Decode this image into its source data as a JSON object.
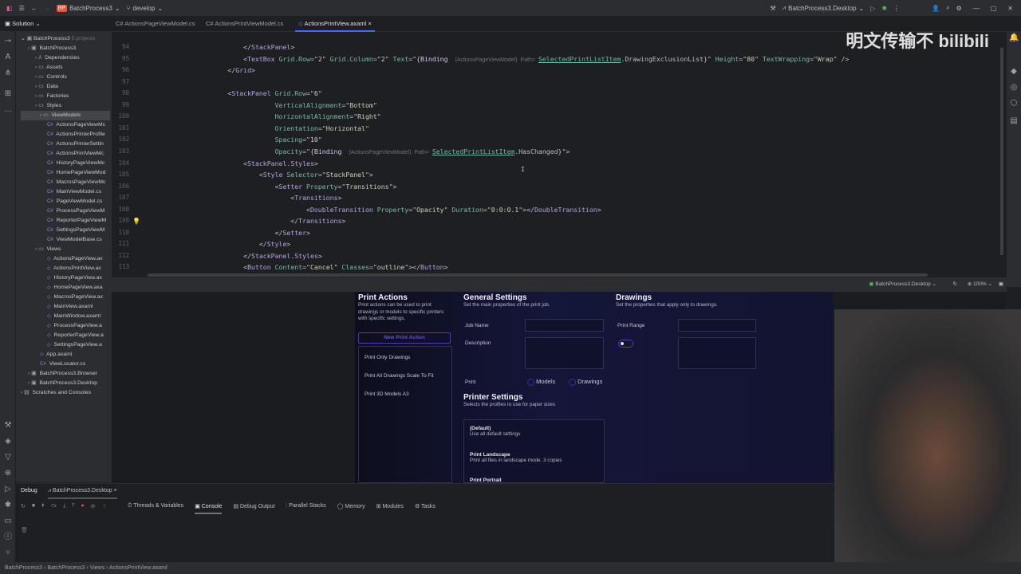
{
  "topbar": {
    "project": "BatchProcess3",
    "project_badge": "BP",
    "branch": "develop",
    "run_config": "BatchProcess3.Desktop"
  },
  "tabs": [
    {
      "label": "ActionsPageViewModel.cs"
    },
    {
      "label": "ActionsPrintViewModel.cs"
    },
    {
      "label": "ActionsPrintView.axaml"
    }
  ],
  "solution": {
    "header": "Solution",
    "root": "BatchProcess3",
    "root_note": "5 projects",
    "items": [
      {
        "label": "BatchProcess3",
        "kind": "project",
        "d": 1
      },
      {
        "label": "Dependencies",
        "kind": "dep",
        "d": 2
      },
      {
        "label": "Assets",
        "kind": "folder",
        "d": 2
      },
      {
        "label": "Controls",
        "kind": "folder",
        "d": 2
      },
      {
        "label": "Data",
        "kind": "folder",
        "d": 2
      },
      {
        "label": "Factories",
        "kind": "folder",
        "d": 2
      },
      {
        "label": "Styles",
        "kind": "folder",
        "d": 2
      },
      {
        "label": "ViewModels",
        "kind": "folder",
        "d": 2
      },
      {
        "label": "ActionsPageViewMc",
        "kind": "cs",
        "d": 3
      },
      {
        "label": "ActionsPrinterProfile",
        "kind": "cs",
        "d": 3
      },
      {
        "label": "ActionsPrinterSettin",
        "kind": "cs",
        "d": 3
      },
      {
        "label": "ActionsPrintViewMc",
        "kind": "cs",
        "d": 3
      },
      {
        "label": "HistoryPageViewMc",
        "kind": "cs",
        "d": 3
      },
      {
        "label": "HomePageViewMod",
        "kind": "cs",
        "d": 3
      },
      {
        "label": "MacrosPageViewMc",
        "kind": "cs",
        "d": 3
      },
      {
        "label": "MainViewModel.cs",
        "kind": "cs",
        "d": 3
      },
      {
        "label": "PageViewModel.cs",
        "kind": "cs",
        "d": 3
      },
      {
        "label": "ProcessPageViewM",
        "kind": "cs",
        "d": 3
      },
      {
        "label": "ReporterPageViewM",
        "kind": "cs",
        "d": 3
      },
      {
        "label": "SettingsPageViewM",
        "kind": "cs",
        "d": 3
      },
      {
        "label": "ViewModelBase.cs",
        "kind": "cs",
        "d": 3
      },
      {
        "label": "Views",
        "kind": "folder",
        "d": 2
      },
      {
        "label": "ActionsPageView.ax",
        "kind": "xaml",
        "d": 3
      },
      {
        "label": "ActionsPrintView.ax",
        "kind": "xaml",
        "d": 3
      },
      {
        "label": "HistoryPageView.ax",
        "kind": "xaml",
        "d": 3
      },
      {
        "label": "HomePageView.axa",
        "kind": "xaml",
        "d": 3
      },
      {
        "label": "MacrosPageView.ax",
        "kind": "xaml",
        "d": 3
      },
      {
        "label": "MainView.axaml",
        "kind": "xaml",
        "d": 3
      },
      {
        "label": "MainWindow.axaml",
        "kind": "xaml",
        "d": 3
      },
      {
        "label": "ProcessPageView.a",
        "kind": "xaml",
        "d": 3
      },
      {
        "label": "ReporterPageView.a",
        "kind": "xaml",
        "d": 3
      },
      {
        "label": "SettingsPageView.a",
        "kind": "xaml",
        "d": 3
      },
      {
        "label": "App.axaml",
        "kind": "xaml",
        "d": 2
      },
      {
        "label": "ViewLocator.cs",
        "kind": "cs",
        "d": 2
      },
      {
        "label": "BatchProcess3.Browser",
        "kind": "project",
        "d": 1
      },
      {
        "label": "BatchProcess3.Desktop",
        "kind": "project",
        "d": 1
      },
      {
        "label": "Scratches and Consoles",
        "kind": "scratch",
        "d": 0
      }
    ]
  },
  "code": [
    {
      "n": "94",
      "s": [
        [
          "punc",
          "            </"
        ],
        [
          "tag",
          "StackPanel"
        ],
        [
          "punc",
          ">"
        ]
      ]
    },
    {
      "n": "95",
      "s": [
        [
          "punc",
          "            <"
        ],
        [
          "tag",
          "TextBox "
        ],
        [
          "attr",
          "Grid.Row"
        ],
        [
          "punc",
          "=\""
        ],
        [
          "val",
          "2"
        ],
        [
          "punc",
          "\" "
        ],
        [
          "attr",
          "Grid.Column"
        ],
        [
          "punc",
          "=\""
        ],
        [
          "val",
          "2"
        ],
        [
          "punc",
          "\" "
        ],
        [
          "attr",
          "Text"
        ],
        [
          "punc",
          "=\"{"
        ],
        [
          "kw",
          "Binding "
        ],
        [
          "hint",
          "(ActionsPageViewModel)  Path="
        ],
        [
          "ref",
          "SelectedPrintListItem"
        ],
        [
          "punc",
          ".DrawingExclusionList}\" "
        ],
        [
          "attr",
          "Height"
        ],
        [
          "punc",
          "=\""
        ],
        [
          "val",
          "80"
        ],
        [
          "punc",
          "\" "
        ],
        [
          "attr",
          "TextWrapping"
        ],
        [
          "punc",
          "=\""
        ],
        [
          "val",
          "Wrap"
        ],
        [
          "punc",
          "\" />"
        ]
      ]
    },
    {
      "n": "96",
      "s": [
        [
          "punc",
          "        </"
        ],
        [
          "tag",
          "Grid"
        ],
        [
          "punc",
          ">"
        ]
      ]
    },
    {
      "n": "97",
      "s": []
    },
    {
      "n": "98",
      "s": [
        [
          "punc",
          "        <"
        ],
        [
          "tag",
          "StackPanel "
        ],
        [
          "attr",
          "Grid.Row"
        ],
        [
          "punc",
          "=\""
        ],
        [
          "val",
          "6"
        ],
        [
          "punc",
          "\""
        ]
      ]
    },
    {
      "n": "99",
      "s": [
        [
          "punc",
          "                    "
        ],
        [
          "attr",
          "VerticalAlignment"
        ],
        [
          "punc",
          "=\""
        ],
        [
          "val",
          "Bottom"
        ],
        [
          "punc",
          "\""
        ]
      ]
    },
    {
      "n": "100",
      "s": [
        [
          "punc",
          "                    "
        ],
        [
          "attr",
          "HorizontalAlignment"
        ],
        [
          "punc",
          "=\""
        ],
        [
          "val",
          "Right"
        ],
        [
          "punc",
          "\""
        ]
      ]
    },
    {
      "n": "101",
      "s": [
        [
          "punc",
          "                    "
        ],
        [
          "attr",
          "Orientation"
        ],
        [
          "punc",
          "=\""
        ],
        [
          "val",
          "Horizontal"
        ],
        [
          "punc",
          "\""
        ]
      ]
    },
    {
      "n": "102",
      "s": [
        [
          "punc",
          "                    "
        ],
        [
          "attr",
          "Spacing"
        ],
        [
          "punc",
          "=\""
        ],
        [
          "val",
          "10"
        ],
        [
          "punc",
          "\""
        ]
      ]
    },
    {
      "n": "103",
      "s": [
        [
          "punc",
          "                    "
        ],
        [
          "attr",
          "Opacity"
        ],
        [
          "punc",
          "=\"{"
        ],
        [
          "kw",
          "Binding "
        ],
        [
          "hint",
          "(ActionsPageViewModel)  Path="
        ],
        [
          "ref",
          "SelectedPrintListItem"
        ],
        [
          "punc",
          ".HasChanged}\">"
        ]
      ]
    },
    {
      "n": "104",
      "s": [
        [
          "punc",
          "            <"
        ],
        [
          "tag",
          "StackPanel.Styles"
        ],
        [
          "punc",
          ">"
        ]
      ]
    },
    {
      "n": "105",
      "s": [
        [
          "punc",
          "                <"
        ],
        [
          "tag",
          "Style "
        ],
        [
          "attr",
          "Selector"
        ],
        [
          "punc",
          "=\""
        ],
        [
          "val",
          "StackPanel"
        ],
        [
          "punc",
          "\">"
        ]
      ]
    },
    {
      "n": "106",
      "s": [
        [
          "punc",
          "                    <"
        ],
        [
          "tag",
          "Setter "
        ],
        [
          "attr",
          "Property"
        ],
        [
          "punc",
          "=\""
        ],
        [
          "val",
          "Transitions"
        ],
        [
          "punc",
          "\">"
        ]
      ]
    },
    {
      "n": "107",
      "s": [
        [
          "punc",
          "                        <"
        ],
        [
          "tag",
          "Transitions"
        ],
        [
          "punc",
          ">"
        ]
      ]
    },
    {
      "n": "108",
      "s": [
        [
          "punc",
          "                            <"
        ],
        [
          "tag",
          "DoubleTransition "
        ],
        [
          "attr",
          "Property"
        ],
        [
          "punc",
          "=\""
        ],
        [
          "val",
          "Opacity"
        ],
        [
          "punc",
          "\" "
        ],
        [
          "attr",
          "Duration"
        ],
        [
          "punc",
          "=\""
        ],
        [
          "val",
          "0:0:0.1"
        ],
        [
          "punc",
          "\"></"
        ],
        [
          "tag",
          "DoubleTransition"
        ],
        [
          "punc",
          ">"
        ]
      ]
    },
    {
      "n": "109",
      "s": [
        [
          "punc",
          "                        </"
        ],
        [
          "tag",
          "Transitions"
        ],
        [
          "punc",
          ">"
        ]
      ]
    },
    {
      "n": "110",
      "s": [
        [
          "punc",
          "                    </"
        ],
        [
          "tag",
          "Setter"
        ],
        [
          "punc",
          ">"
        ]
      ]
    },
    {
      "n": "111",
      "s": [
        [
          "punc",
          "                </"
        ],
        [
          "tag",
          "Style"
        ],
        [
          "punc",
          ">"
        ]
      ]
    },
    {
      "n": "112",
      "s": [
        [
          "punc",
          "            </"
        ],
        [
          "tag",
          "StackPanel.Styles"
        ],
        [
          "punc",
          ">"
        ]
      ]
    },
    {
      "n": "113",
      "s": [
        [
          "punc",
          "            <"
        ],
        [
          "tag",
          "Button "
        ],
        [
          "attr",
          "Content"
        ],
        [
          "punc",
          "=\""
        ],
        [
          "val",
          "Cancel"
        ],
        [
          "punc",
          "\" "
        ],
        [
          "attr",
          "Classes"
        ],
        [
          "punc",
          "=\""
        ],
        [
          "val",
          "outline"
        ],
        [
          "punc",
          "\"></"
        ],
        [
          "tag",
          "Button"
        ],
        [
          "punc",
          ">"
        ]
      ]
    }
  ],
  "preview_bar": {
    "target": "BatchProcess3.Desktop",
    "zoom": "100%"
  },
  "app": {
    "print_actions": {
      "title": "Print Actions",
      "desc": "Print actions can be used to print drawings or models to specific printers with specific settings.",
      "new_button": "New Print Action",
      "items": [
        "Print Only Drawings",
        "Print All Drawings Scale To Fit",
        "Print 3D Models A3"
      ]
    },
    "general": {
      "title": "General Settings",
      "desc": "Set the main properties of the print job.",
      "job_name": "Job Name",
      "description": "Description",
      "print": "Print",
      "models": "Models",
      "drawings": "Drawings"
    },
    "printer": {
      "title": "Printer Settings",
      "desc": "Selects the profiles to use for paper sizes",
      "profiles": [
        {
          "name": "(Default)",
          "desc": "Use all default settings"
        },
        {
          "name": "Print Landscape",
          "desc": "Print all files in landscape mode. 3 copies"
        },
        {
          "name": "Print Portrait",
          "desc": ""
        }
      ]
    },
    "drawings": {
      "title": "Drawings",
      "desc": "Set the properties that apply only to drawings.",
      "print_range": "Print Range"
    }
  },
  "debug": {
    "tab": "Debug",
    "config": "BatchProcess3.Desktop",
    "tabs": [
      "Threads & Variables",
      "Console",
      "Debug Output",
      "Parallel Stacks",
      "Memory",
      "Modules",
      "Tasks"
    ],
    "active": "Console"
  },
  "status": {
    "crumbs": [
      "BatchProcess3",
      "BatchProcess3",
      "Views",
      "ActionsPrintView.axaml"
    ]
  },
  "watermark": "明文传输不 bilibili",
  "colors": {
    "accent": "#3574f0",
    "app_purple": "#6a3de8"
  }
}
